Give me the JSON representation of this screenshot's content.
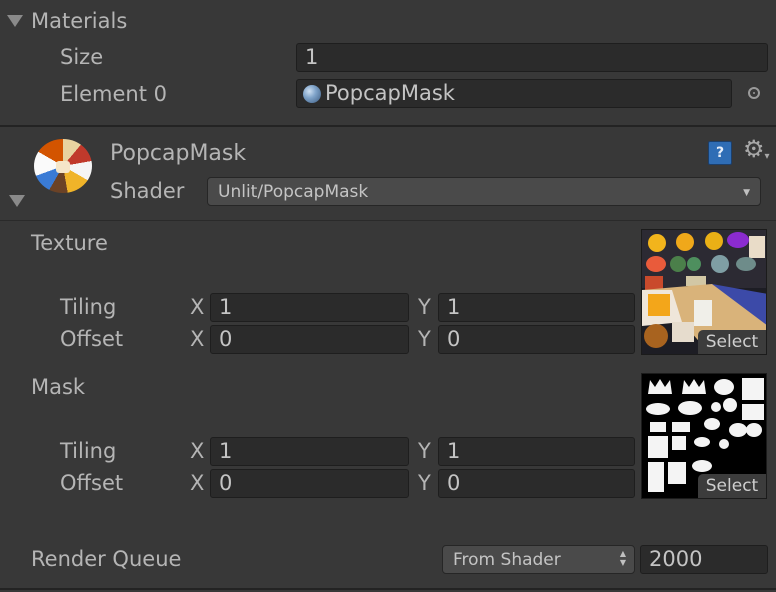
{
  "materials": {
    "title": "Materials",
    "size_label": "Size",
    "size_value": "1",
    "element_label": "Element 0",
    "element_value": "PopcapMask"
  },
  "material": {
    "name": "PopcapMask",
    "shader_label": "Shader",
    "shader_value": "Unlit/PopcapMask"
  },
  "properties": [
    {
      "name": "Texture",
      "tiling_label": "Tiling",
      "offset_label": "Offset",
      "x_label": "X",
      "y_label": "Y",
      "tiling_x": "1",
      "tiling_y": "1",
      "offset_x": "0",
      "offset_y": "0",
      "select_label": "Select"
    },
    {
      "name": "Mask",
      "tiling_label": "Tiling",
      "offset_label": "Offset",
      "x_label": "X",
      "y_label": "Y",
      "tiling_x": "1",
      "tiling_y": "1",
      "offset_x": "0",
      "offset_y": "0",
      "select_label": "Select"
    }
  ],
  "render_queue": {
    "label": "Render Queue",
    "mode": "From Shader",
    "value": "2000"
  },
  "colors": {
    "background": "#383838",
    "field": "#2b2b2b",
    "text": "#b8b8b8"
  }
}
